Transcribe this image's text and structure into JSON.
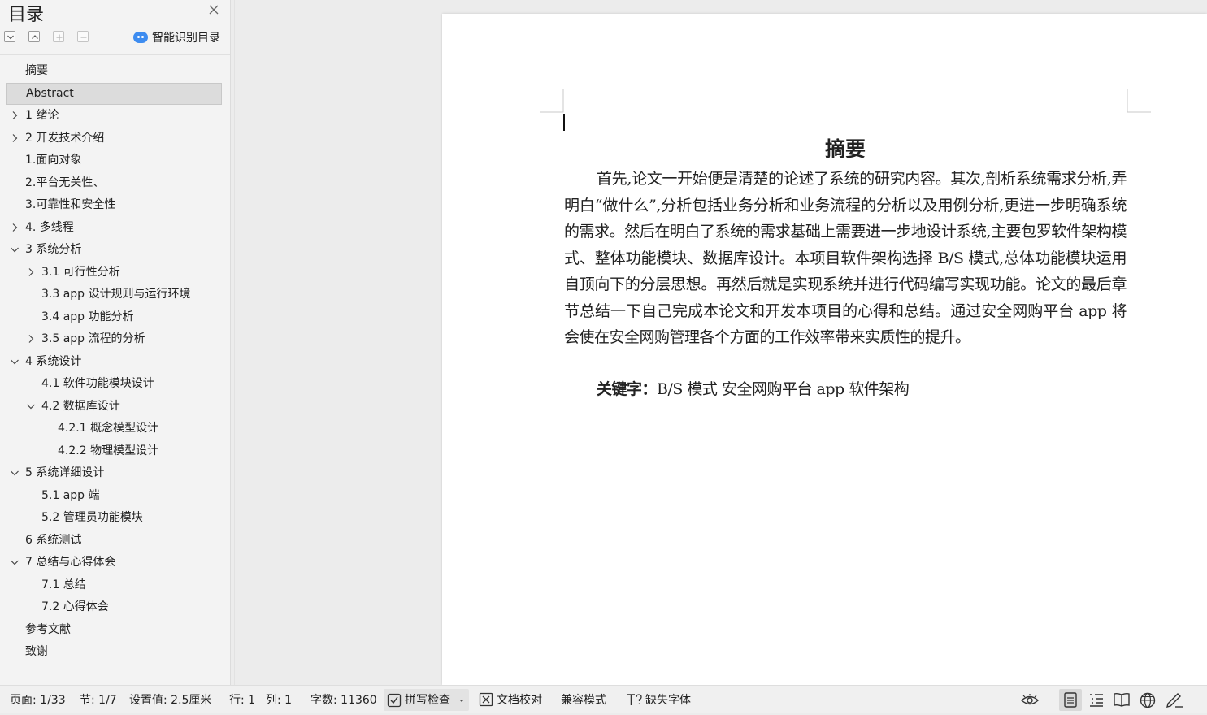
{
  "sidebar": {
    "title": "目录",
    "smart_label": "智能识别目录",
    "items": [
      {
        "label": "摘要",
        "level": 0,
        "chevron": "none"
      },
      {
        "label": "Abstract",
        "level": 0,
        "chevron": "none",
        "selected": true
      },
      {
        "label": "1 绪论",
        "level": 0,
        "chevron": "right"
      },
      {
        "label": "2 开发技术介绍",
        "level": 0,
        "chevron": "right"
      },
      {
        "label": "1.面向对象",
        "level": 0,
        "chevron": "none"
      },
      {
        "label": "2.平台无关性、",
        "level": 0,
        "chevron": "none"
      },
      {
        "label": "3.可靠性和安全性",
        "level": 0,
        "chevron": "none"
      },
      {
        "label": "4. 多线程",
        "level": 0,
        "chevron": "right"
      },
      {
        "label": "3 系统分析",
        "level": 0,
        "chevron": "down"
      },
      {
        "label": "3.1 可行性分析",
        "level": 1,
        "chevron": "right"
      },
      {
        "label": "3.3 app 设计规则与运行环境",
        "level": 1,
        "chevron": "none"
      },
      {
        "label": "3.4 app 功能分析",
        "level": 1,
        "chevron": "none"
      },
      {
        "label": "3.5 app 流程的分析",
        "level": 1,
        "chevron": "right"
      },
      {
        "label": "4 系统设计",
        "level": 0,
        "chevron": "down"
      },
      {
        "label": "4.1  软件功能模块设计",
        "level": 1,
        "chevron": "none"
      },
      {
        "label": "4.2  数据库设计",
        "level": 1,
        "chevron": "down"
      },
      {
        "label": "4.2.1  概念模型设计",
        "level": 2,
        "chevron": "none"
      },
      {
        "label": "4.2.2  物理模型设计",
        "level": 2,
        "chevron": "none"
      },
      {
        "label": "5 系统详细设计",
        "level": 0,
        "chevron": "down"
      },
      {
        "label": "5.1 app 端",
        "level": 1,
        "chevron": "none"
      },
      {
        "label": "5.2 管理员功能模块",
        "level": 1,
        "chevron": "none"
      },
      {
        "label": "6 系统测试",
        "level": 0,
        "chevron": "none"
      },
      {
        "label": "7 总结与心得体会",
        "level": 0,
        "chevron": "down"
      },
      {
        "label": "7.1  总结",
        "level": 1,
        "chevron": "none"
      },
      {
        "label": "7.2  心得体会",
        "level": 1,
        "chevron": "none"
      },
      {
        "label": "参考文献",
        "level": 0,
        "chevron": "none"
      },
      {
        "label": "致谢",
        "level": 0,
        "chevron": "none"
      }
    ]
  },
  "document": {
    "heading": "摘要",
    "body": "首先,论文一开始便是清楚的论述了系统的研究内容。其次,剖析系统需求分析,弄明白“做什么”,分析包括业务分析和业务流程的分析以及用例分析,更进一步明确系统的需求。然后在明白了系统的需求基础上需要进一步地设计系统,主要包罗软件架构模式、整体功能模块、数据库设计。本项目软件架构选择 B/S 模式,总体功能模块运用自顶向下的分层思想。再然后就是实现系统并进行代码编写实现功能。论文的最后章节总结一下自己完成本论文和开发本项目的心得和总结。通过安全网购平台 app 将会使在安全网购管理各个方面的工作效率带来实质性的提升。",
    "keywords_label": "关键字：",
    "keywords": "B/S 模式  安全网购平台 app  软件架构"
  },
  "statusbar": {
    "page": "页面: 1/33",
    "section": "节: 1/7",
    "setting": "设置值: 2.5厘米",
    "row": "行: 1",
    "col": "列: 1",
    "wordcount": "字数: 11360",
    "spellcheck": "拼写检查",
    "proofread": "文档校对",
    "compat": "兼容模式",
    "missing_font": "缺失字体"
  }
}
